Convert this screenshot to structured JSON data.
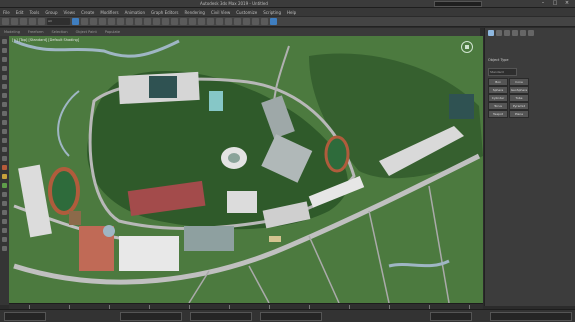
{
  "window": {
    "title": "Autodesk 3ds Max 2019 - Untitled",
    "search_placeholder": "",
    "minimize": "–",
    "maximize": "□",
    "close": "×"
  },
  "menubar": {
    "items": [
      "File",
      "Edit",
      "Tools",
      "Group",
      "Views",
      "Create",
      "Modifiers",
      "Animation",
      "Graph Editors",
      "Rendering",
      "Civil View",
      "Customize",
      "Scripting",
      "Help"
    ]
  },
  "toolbar": {
    "selection_dropdown": "All"
  },
  "ribbon": {
    "tabs": [
      "Modeling",
      "Freeform",
      "Selection",
      "Object Paint",
      "Populate"
    ]
  },
  "viewport": {
    "label": "[+] [Top] [Standard] [Default Shading]"
  },
  "command_panel": {
    "tabs": [
      "create",
      "modify",
      "hierarchy",
      "motion",
      "display",
      "utilities"
    ],
    "active_tab": "create",
    "dropdown": "Standard",
    "section_title": "Object Type",
    "buttons": [
      "Box",
      "Cone",
      "Sphere",
      "GeoSphere",
      "Cylinder",
      "Tube",
      "Torus",
      "Pyramid",
      "Teapot",
      "Plane"
    ]
  },
  "colors": {
    "grass": "#4f7f3f",
    "road": "#9a9a9a",
    "track": "#b05c3c",
    "water": "#9fb6c4",
    "roof_red": "#a34b4b",
    "roof_white": "#e6e6e6",
    "accent": "#3f7ec0"
  }
}
